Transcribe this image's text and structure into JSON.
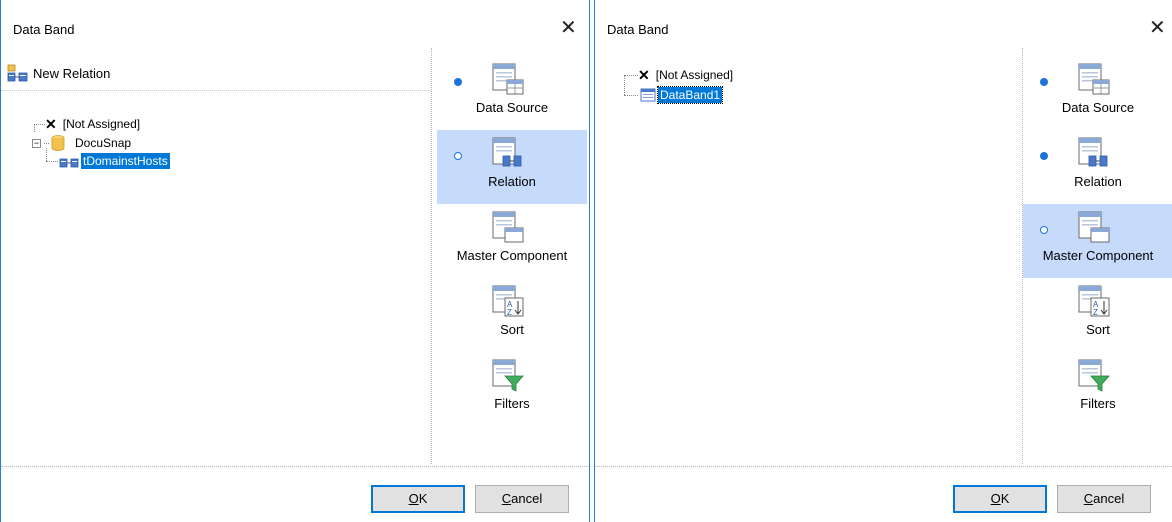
{
  "left_dialog": {
    "title": "Data Band",
    "toolbar": {
      "new_relation_label": "New Relation"
    },
    "tree": {
      "not_assigned": "[Not Assigned]",
      "datasource": "DocuSnap",
      "relation": "tDomainstHosts"
    },
    "nav": [
      {
        "label": "Data Source",
        "icon": "data-source-icon",
        "dot": true,
        "active": false
      },
      {
        "label": "Relation",
        "icon": "relation-icon",
        "dot": true,
        "active": true
      },
      {
        "label": "Master Component",
        "icon": "master-component-icon",
        "dot": false,
        "active": false
      },
      {
        "label": "Sort",
        "icon": "sort-icon",
        "dot": false,
        "active": false
      },
      {
        "label": "Filters",
        "icon": "filters-icon",
        "dot": false,
        "active": false
      }
    ],
    "buttons": {
      "ok_mnemonic": "O",
      "ok_rest": "K",
      "cancel_mnemonic": "C",
      "cancel_rest": "ancel"
    }
  },
  "right_dialog": {
    "title": "Data Band",
    "tree": {
      "not_assigned": "[Not Assigned]",
      "component": "DataBand1"
    },
    "nav": [
      {
        "label": "Data Source",
        "icon": "data-source-icon",
        "dot": true,
        "active": false
      },
      {
        "label": "Relation",
        "icon": "relation-icon",
        "dot": true,
        "active": false
      },
      {
        "label": "Master Component",
        "icon": "master-component-icon",
        "dot": true,
        "active": true
      },
      {
        "label": "Sort",
        "icon": "sort-icon",
        "dot": false,
        "active": false
      },
      {
        "label": "Filters",
        "icon": "filters-icon",
        "dot": false,
        "active": false
      }
    ],
    "buttons": {
      "ok_mnemonic": "O",
      "ok_rest": "K",
      "cancel_mnemonic": "C",
      "cancel_rest": "ancel"
    }
  },
  "colors": {
    "selection": "#0078d7",
    "active_nav": "#c6dafc",
    "dot": "#1e73d8",
    "window_border": "#2b79d8",
    "filter_green": "#3fae5a"
  }
}
